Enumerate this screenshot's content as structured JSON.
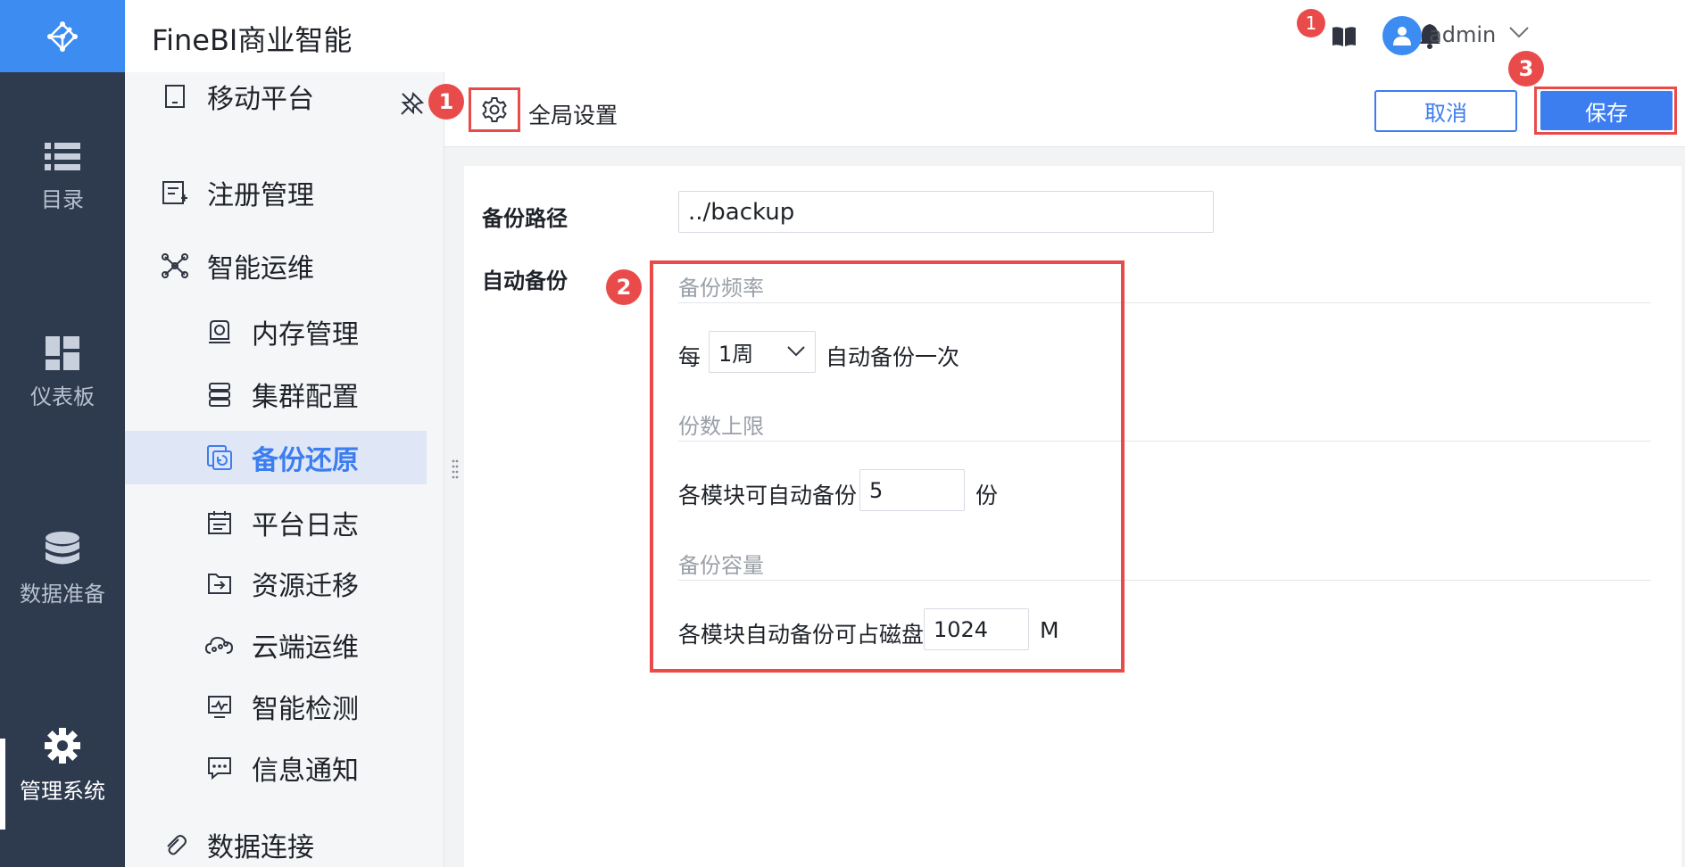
{
  "app": {
    "title": "FineBI商业智能"
  },
  "colors": {
    "accent": "#3c7df0",
    "rail_bg": "#2e3a4e",
    "logo_bg": "#3c8cf2",
    "annotation": "#e94b4b"
  },
  "rail": {
    "items": [
      {
        "label": "目录",
        "icon": "list-icon"
      },
      {
        "label": "仪表板",
        "icon": "dashboard-icon"
      },
      {
        "label": "数据准备",
        "icon": "database-icon"
      },
      {
        "label": "管理系统",
        "icon": "gear-icon",
        "active": true
      }
    ]
  },
  "header": {
    "notifications_count": "1",
    "user_name": "admin"
  },
  "subnav": {
    "items": [
      {
        "label": "移动平台",
        "icon": "mobile-icon"
      },
      {
        "label": "注册管理",
        "icon": "register-icon"
      },
      {
        "label": "智能运维",
        "icon": "network-icon"
      },
      {
        "label": "内存管理",
        "icon": "memory-icon"
      },
      {
        "label": "集群配置",
        "icon": "cluster-icon"
      },
      {
        "label": "备份还原",
        "icon": "backup-icon",
        "active": true
      },
      {
        "label": "平台日志",
        "icon": "log-icon"
      },
      {
        "label": "资源迁移",
        "icon": "migrate-icon"
      },
      {
        "label": "云端运维",
        "icon": "cloud-icon"
      },
      {
        "label": "智能检测",
        "icon": "monitor-icon"
      },
      {
        "label": "信息通知",
        "icon": "message-icon"
      },
      {
        "label": "数据连接",
        "icon": "link-icon"
      }
    ]
  },
  "toolbar": {
    "title": "全局设置",
    "cancel_label": "取消",
    "save_label": "保存"
  },
  "form": {
    "backup_path_label": "备份路径",
    "backup_path_value": "../backup",
    "auto_backup_label": "自动备份",
    "frequency": {
      "heading": "备份频率",
      "prefix": "每",
      "selected": "1周",
      "suffix": "自动备份一次"
    },
    "count_limit": {
      "heading": "份数上限",
      "prefix": "各模块可自动备份",
      "value": "5",
      "suffix": "份"
    },
    "capacity": {
      "heading": "备份容量",
      "prefix": "各模块自动备份可占磁盘",
      "value": "1024",
      "suffix": "M"
    }
  },
  "annotations": {
    "m1": "1",
    "m2": "2",
    "m3": "3"
  }
}
